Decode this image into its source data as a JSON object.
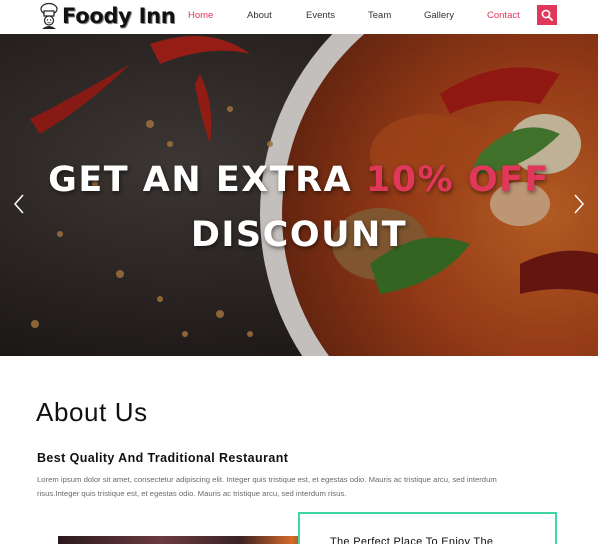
{
  "colors": {
    "accent": "#e1375a",
    "feature_border": "#3fd7a0",
    "text_dark": "#111111",
    "text_muted": "#6a6a6a"
  },
  "header": {
    "logo_text": "Foody Inn",
    "logo_icon": "chef-hat-icon",
    "nav": [
      {
        "label": "Home",
        "active": true
      },
      {
        "label": "About",
        "active": false
      },
      {
        "label": "Events",
        "active": false
      },
      {
        "label": "Team",
        "active": false
      },
      {
        "label": "Gallery",
        "active": false
      },
      {
        "label": "Contact",
        "active": false
      }
    ],
    "search_icon": "search-icon"
  },
  "hero": {
    "line1_prefix": "GET AN EXTRA ",
    "line1_highlight": "10% OFF",
    "line2": "DISCOUNT",
    "prev_icon": "chevron-left-icon",
    "next_icon": "chevron-right-icon"
  },
  "about": {
    "title": "About Us",
    "subtitle": "Best Quality And Traditional Restaurant",
    "paragraph": "Lorem ipsum dolor sit amet, consectetur adipiscing elit. Integer quis tristique est, et egestas odio. Mauris ac tristique arcu, sed interdum risus.Integer quis tristique est, et egestas odio. Mauris ac tristique arcu, sed interdum risus.",
    "feature_title": "The Perfect Place To Enjoy The"
  }
}
